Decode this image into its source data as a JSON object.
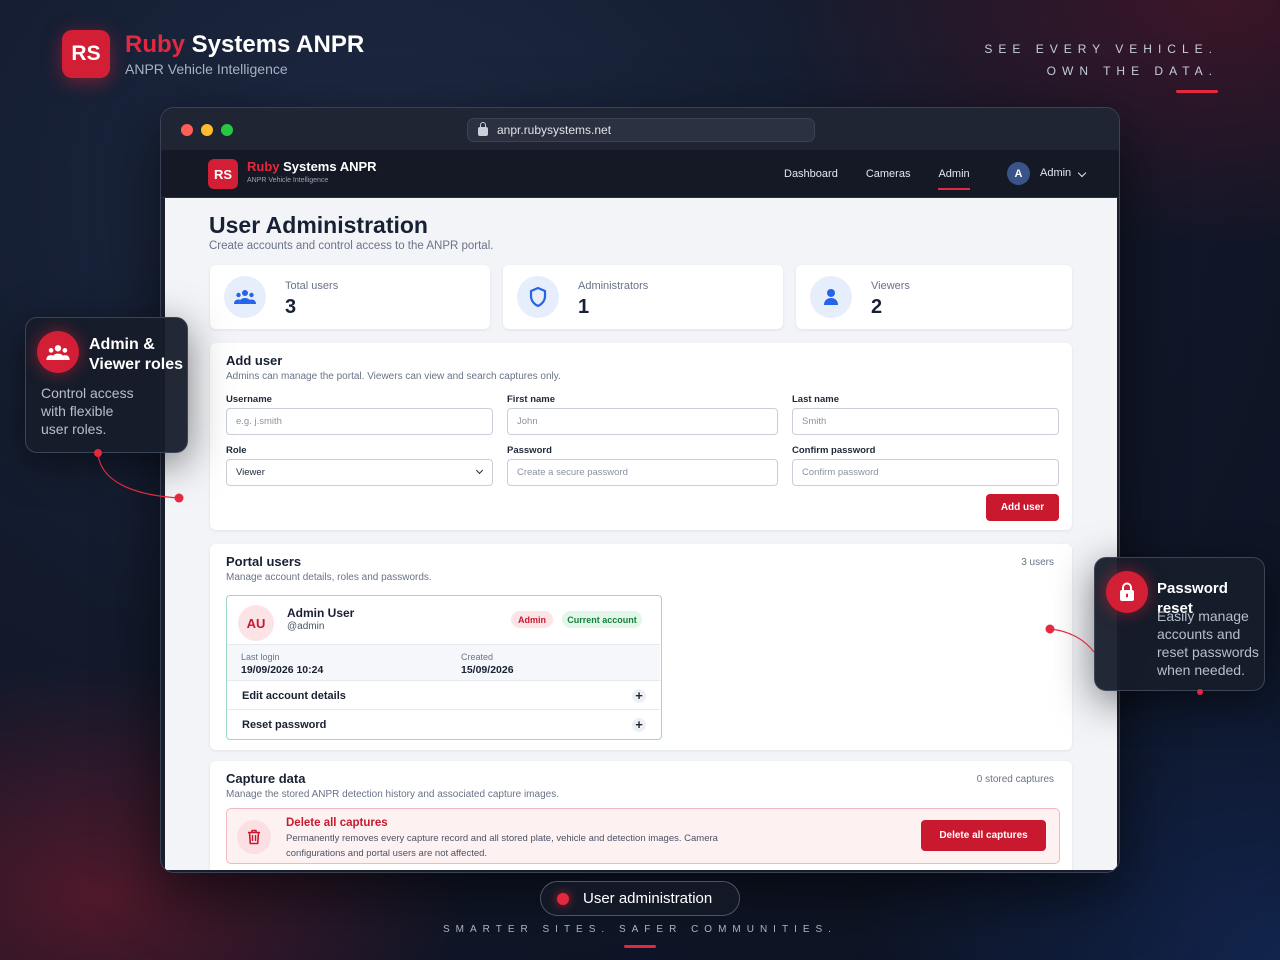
{
  "brand": {
    "logo": "RS",
    "name_accent": "Ruby",
    "name_rest": " Systems ANPR",
    "subtitle": "ANPR Vehicle Intelligence"
  },
  "tagline": {
    "line1": "SEE EVERY VEHICLE.",
    "line2": "OWN THE DATA."
  },
  "browser": {
    "url": "anpr.rubysystems.net"
  },
  "nav": {
    "logo": "RS",
    "name_accent": "Ruby",
    "name_rest": " Systems ANPR",
    "subtitle": "ANPR Vehicle Intelligence",
    "links": [
      {
        "label": "Dashboard"
      },
      {
        "label": "Cameras"
      },
      {
        "label": "Admin",
        "active": true
      }
    ],
    "avatar": "A",
    "user": "Admin"
  },
  "page": {
    "title": "User Administration",
    "subtitle": "Create accounts and control access to the ANPR portal."
  },
  "stats": [
    {
      "label": "Total users",
      "value": "3",
      "icon": "users-icon"
    },
    {
      "label": "Administrators",
      "value": "1",
      "icon": "shield-icon"
    },
    {
      "label": "Viewers",
      "value": "2",
      "icon": "user-icon"
    }
  ],
  "add_user": {
    "title": "Add user",
    "subtitle": "Admins can manage the portal. Viewers can view and search captures only.",
    "username_label": "Username",
    "username_placeholder": "e.g. j.smith",
    "first_label": "First name",
    "first_placeholder": "John",
    "last_label": "Last name",
    "last_placeholder": "Smith",
    "role_label": "Role",
    "role_value": "Viewer",
    "password_label": "Password",
    "password_placeholder": "Create a secure password",
    "confirm_label": "Confirm password",
    "confirm_placeholder": "Confirm password",
    "button": "Add user"
  },
  "portal_users": {
    "title": "Portal users",
    "subtitle": "Manage account details, roles and passwords.",
    "count": "3 users",
    "user": {
      "initials": "AU",
      "name": "Admin User",
      "handle": "@admin",
      "role_badge": "Admin",
      "current_badge": "Current account",
      "last_login_label": "Last login",
      "last_login": "19/09/2026 10:24",
      "created_label": "Created",
      "created": "15/09/2026",
      "edit_label": "Edit account details",
      "reset_label": "Reset password"
    }
  },
  "capture": {
    "title": "Capture data",
    "subtitle": "Manage the stored ANPR detection history and associated capture images.",
    "count": "0 stored captures",
    "danger_title": "Delete all captures",
    "danger_text": "Permanently removes every capture record and all stored plate, vehicle and detection images. Camera configurations and portal users are not affected.",
    "button": "Delete all captures"
  },
  "callout_left": {
    "title_line1": "Admin &",
    "title_line2": "Viewer roles",
    "text_line1": "Control access",
    "text_line2": "with flexible",
    "text_line3": "user roles."
  },
  "callout_right": {
    "title": "Password reset",
    "text_line1": "Easily manage",
    "text_line2": "accounts and",
    "text_line3": "reset passwords",
    "text_line4": "when needed."
  },
  "bottom": {
    "pill": "User administration",
    "tagline": "SMARTER SITES. SAFER COMMUNITIES."
  },
  "colors": {
    "accent": "#d21f36",
    "primary_blue": "#2563eb",
    "success_green": "#16a34a",
    "background": "#121a2c"
  }
}
